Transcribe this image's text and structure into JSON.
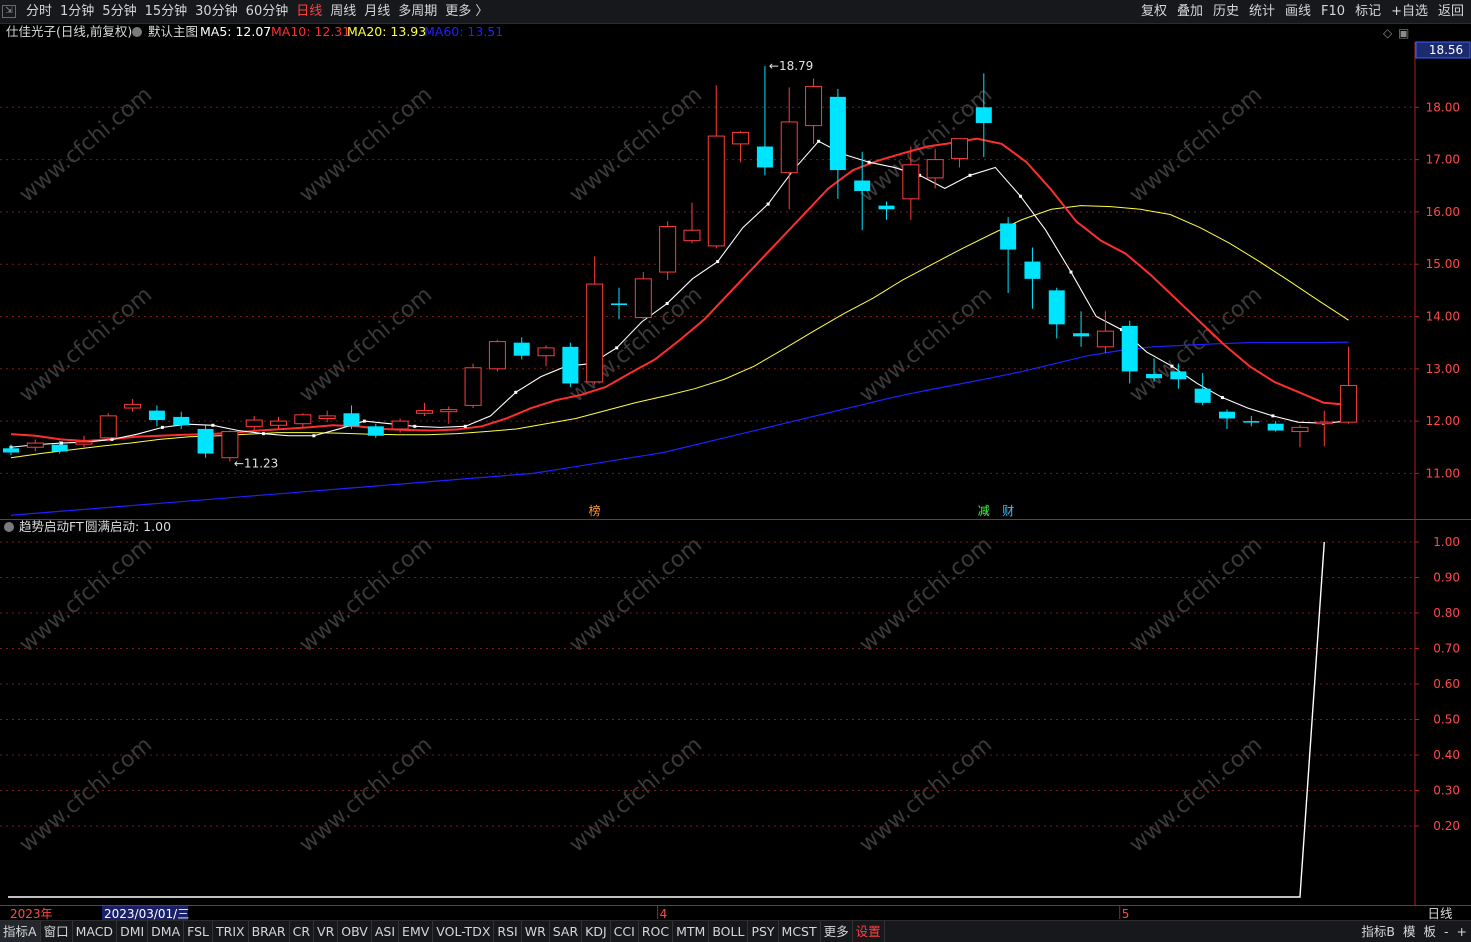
{
  "toolbar": {
    "corner_icon": "restore-window-icon",
    "periods": [
      {
        "label": "分时"
      },
      {
        "label": "1分钟"
      },
      {
        "label": "5分钟"
      },
      {
        "label": "15分钟"
      },
      {
        "label": "30分钟"
      },
      {
        "label": "60分钟"
      },
      {
        "label": "日线",
        "active": true
      },
      {
        "label": "周线"
      },
      {
        "label": "月线"
      },
      {
        "label": "多周期"
      },
      {
        "label": "更多 〉"
      }
    ],
    "tools": [
      "复权",
      "叠加",
      "历史",
      "统计",
      "画线",
      "F10",
      "标记",
      "+自选",
      "返回"
    ]
  },
  "main_panel": {
    "stock_title": "仕佳光子(日线,前复权)",
    "template_name": "默认主图",
    "mas": [
      {
        "label": "MA5: 12.07",
        "color": "#ffffff",
        "period": 5
      },
      {
        "label": "MA10: 12.31",
        "color": "#ff2e2e",
        "period": 10
      },
      {
        "label": "MA20: 13.93",
        "color": "#ffff40",
        "period": 20
      },
      {
        "label": "MA60: 13.51",
        "color": "#2020ff",
        "period": 60
      }
    ],
    "last_price_tag": "18.56",
    "high_label": "18.79",
    "low_label": "11.23",
    "event_marks": [
      {
        "text": "榜",
        "color": "#ff9933",
        "bar": 24
      },
      {
        "text": "减",
        "color": "#40ff40",
        "bar": 40
      },
      {
        "text": "财",
        "color": "#40c0ff",
        "bar": 41
      }
    ],
    "y_ticks": [
      "18.00",
      "17.00",
      "16.00",
      "15.00",
      "14.00",
      "13.00",
      "12.00",
      "11.00"
    ]
  },
  "sub_panel": {
    "title": "趋势启动FT",
    "value_label": "圆满启动: 1.00",
    "y_ticks": [
      "1.00",
      "0.90",
      "0.80",
      "0.70",
      "0.60",
      "0.50",
      "0.40",
      "0.30",
      "0.20"
    ]
  },
  "time_axis": {
    "year_label": "2023年",
    "cursor_date": "2023/03/01/三",
    "month_labels": [
      {
        "text": "4",
        "bar": 27
      },
      {
        "text": "5",
        "bar": 46
      }
    ],
    "period_label": "日线"
  },
  "watermark": "www.cfchi.com",
  "indicators": [
    "指标A",
    "窗口",
    "MACD",
    "DMI",
    "DMA",
    "FSL",
    "TRIX",
    "BRAR",
    "CR",
    "VR",
    "OBV",
    "ASI",
    "EMV",
    "VOL-TDX",
    "RSI",
    "WR",
    "SAR",
    "KDJ",
    "CCI",
    "ROC",
    "MTM",
    "BOLL",
    "PSY",
    "MCST",
    "更多",
    "设置"
  ],
  "bottom_right": [
    "指标B",
    "模",
    "板",
    "-",
    "+"
  ],
  "colors": {
    "up": "#ff3c3c",
    "down": "#00e5ff",
    "grid": "#7a1a1a",
    "axis_border": "#b21e1e",
    "ma5": "#ffffff",
    "ma10": "#ff2e2e",
    "ma20": "#ffff40",
    "ma60": "#2020ff"
  },
  "chart_data": {
    "type": "candlestick",
    "series": [
      {
        "name": "K线",
        "ohlc": [
          [
            11.48,
            11.55,
            11.35,
            11.4
          ],
          [
            11.5,
            11.65,
            11.42,
            11.58
          ],
          [
            11.55,
            11.62,
            11.38,
            11.42
          ],
          [
            11.56,
            11.72,
            11.5,
            11.6
          ],
          [
            11.68,
            12.15,
            11.62,
            12.1
          ],
          [
            12.25,
            12.42,
            12.18,
            12.32
          ],
          [
            12.2,
            12.3,
            11.9,
            12.02
          ],
          [
            12.08,
            12.18,
            11.85,
            11.92
          ],
          [
            11.85,
            11.92,
            11.3,
            11.38
          ],
          [
            11.3,
            11.82,
            11.23,
            11.8
          ],
          [
            11.9,
            12.1,
            11.82,
            12.02
          ],
          [
            11.92,
            12.08,
            11.85,
            12.0
          ],
          [
            11.95,
            12.15,
            11.88,
            12.12
          ],
          [
            12.05,
            12.2,
            11.98,
            12.1
          ],
          [
            12.15,
            12.3,
            11.85,
            11.9
          ],
          [
            11.9,
            11.95,
            11.68,
            11.72
          ],
          [
            11.85,
            12.05,
            11.78,
            12.0
          ],
          [
            12.15,
            12.35,
            12.1,
            12.2
          ],
          [
            12.18,
            12.28,
            11.95,
            12.22
          ],
          [
            12.3,
            13.1,
            12.25,
            13.02
          ],
          [
            13.0,
            13.55,
            12.95,
            13.52
          ],
          [
            13.5,
            13.6,
            13.18,
            13.25
          ],
          [
            13.25,
            13.45,
            13.05,
            13.4
          ],
          [
            13.42,
            13.5,
            12.65,
            12.72
          ],
          [
            12.75,
            15.15,
            12.7,
            14.62
          ],
          [
            14.25,
            14.55,
            13.95,
            14.22
          ],
          [
            13.98,
            14.85,
            13.95,
            14.72
          ],
          [
            14.85,
            15.82,
            14.7,
            15.72
          ],
          [
            15.45,
            16.18,
            15.4,
            15.65
          ],
          [
            15.35,
            18.42,
            15.3,
            17.45
          ],
          [
            17.3,
            17.55,
            16.95,
            17.52
          ],
          [
            17.25,
            18.79,
            16.7,
            16.85
          ],
          [
            16.75,
            18.38,
            16.05,
            17.72
          ],
          [
            17.65,
            18.55,
            17.3,
            18.4
          ],
          [
            18.2,
            18.35,
            16.25,
            16.8
          ],
          [
            16.6,
            17.15,
            15.65,
            16.4
          ],
          [
            16.12,
            16.2,
            15.85,
            16.05
          ],
          [
            16.25,
            17.25,
            15.85,
            16.9
          ],
          [
            16.65,
            17.2,
            16.45,
            17.0
          ],
          [
            17.02,
            17.35,
            16.85,
            17.4
          ],
          [
            18.0,
            18.65,
            17.05,
            17.7
          ],
          [
            15.78,
            15.9,
            14.45,
            15.28
          ],
          [
            15.05,
            15.32,
            14.15,
            14.72
          ],
          [
            14.5,
            14.55,
            13.58,
            13.85
          ],
          [
            13.68,
            14.1,
            13.42,
            13.62
          ],
          [
            13.42,
            14.1,
            13.3,
            13.72
          ],
          [
            13.82,
            13.92,
            12.72,
            12.95
          ],
          [
            12.9,
            13.2,
            12.75,
            12.82
          ],
          [
            12.95,
            13.1,
            12.62,
            12.8
          ],
          [
            12.62,
            12.92,
            12.3,
            12.35
          ],
          [
            12.18,
            12.22,
            11.85,
            12.05
          ],
          [
            12.0,
            12.1,
            11.9,
            11.98
          ],
          [
            11.95,
            12.0,
            11.8,
            11.82
          ],
          [
            11.8,
            11.92,
            11.5,
            11.88
          ],
          [
            11.95,
            12.2,
            11.52,
            11.98
          ],
          [
            11.98,
            13.42,
            11.95,
            12.68
          ]
        ]
      },
      {
        "name": "MA5",
        "values": [
          11.5,
          11.55,
          11.58,
          11.6,
          11.65,
          11.75,
          11.88,
          11.94,
          11.92,
          11.82,
          11.76,
          11.72,
          11.72,
          11.85,
          12.0,
          11.95,
          11.9,
          11.88,
          11.9,
          12.1,
          12.55,
          12.85,
          13.05,
          13.1,
          13.4,
          13.9,
          14.25,
          14.72,
          15.05,
          15.7,
          16.15,
          16.8,
          17.35,
          17.1,
          16.95,
          16.85,
          16.7,
          16.45,
          16.7,
          16.85,
          16.3,
          15.65,
          14.85,
          14.0,
          13.75,
          13.32,
          13.05,
          12.72,
          12.45,
          12.25,
          12.1,
          11.98,
          11.96,
          12.0
        ]
      },
      {
        "name": "MA10",
        "values": [
          11.75,
          11.72,
          11.65,
          11.62,
          11.65,
          11.7,
          11.72,
          11.74,
          11.75,
          11.78,
          11.82,
          11.85,
          11.88,
          11.92,
          11.9,
          11.85,
          11.83,
          11.82,
          11.84,
          11.9,
          12.05,
          12.25,
          12.4,
          12.5,
          12.65,
          12.92,
          13.18,
          13.55,
          13.95,
          14.45,
          14.95,
          15.45,
          15.95,
          16.45,
          16.8,
          16.98,
          17.12,
          17.25,
          17.32,
          17.4,
          17.3,
          16.95,
          16.42,
          15.82,
          15.45,
          15.2,
          14.8,
          14.35,
          13.9,
          13.45,
          13.05,
          12.75,
          12.55,
          12.35,
          12.31
        ]
      },
      {
        "name": "MA20",
        "values": [
          11.3,
          11.38,
          11.45,
          11.52,
          11.58,
          11.65,
          11.7,
          11.72,
          11.75,
          11.78,
          11.78,
          11.77,
          11.75,
          11.74,
          11.74,
          11.76,
          11.8,
          11.85,
          11.95,
          12.05,
          12.2,
          12.35,
          12.48,
          12.62,
          12.8,
          13.05,
          13.38,
          13.72,
          14.05,
          14.35,
          14.7,
          15.0,
          15.3,
          15.58,
          15.85,
          16.05,
          16.12,
          16.1,
          16.05,
          15.95,
          15.7,
          15.4,
          15.05,
          14.68,
          14.3,
          13.93
        ]
      },
      {
        "name": "MA60",
        "values": [
          10.2,
          10.25,
          10.3,
          10.35,
          10.4,
          10.45,
          10.5,
          10.55,
          10.6,
          10.65,
          10.7,
          10.75,
          10.8,
          10.85,
          10.9,
          10.95,
          11.0,
          11.1,
          11.2,
          11.3,
          11.4,
          11.55,
          11.7,
          11.85,
          12.0,
          12.15,
          12.3,
          12.45,
          12.58,
          12.7,
          12.82,
          12.95,
          13.1,
          13.25,
          13.35,
          13.42,
          13.45,
          13.48,
          13.5,
          13.5,
          13.5,
          13.51
        ]
      },
      {
        "name": "趋势启动FT",
        "values": [
          0.0,
          0.0,
          0.0,
          0.0,
          0.0,
          0.0,
          0.0,
          0.0,
          0.0,
          0.0,
          0.0,
          0.0,
          0.0,
          0.0,
          0.0,
          0.0,
          0.0,
          0.0,
          0.0,
          0.0,
          0.0,
          0.0,
          0.0,
          0.0,
          0.0,
          0.0,
          0.0,
          0.0,
          0.0,
          0.0,
          0.0,
          0.0,
          0.0,
          0.0,
          0.0,
          0.0,
          0.0,
          0.0,
          0.0,
          0.0,
          0.0,
          0.0,
          0.0,
          0.0,
          0.0,
          0.0,
          0.0,
          0.0,
          0.0,
          0.0,
          0.0,
          0.0,
          0.0,
          0.0,
          1.0
        ]
      }
    ],
    "main_ylim": [
      10.22,
      19.08
    ],
    "sub_ylim": [
      0,
      1.05
    ],
    "grid": true,
    "legend": "top-left"
  }
}
